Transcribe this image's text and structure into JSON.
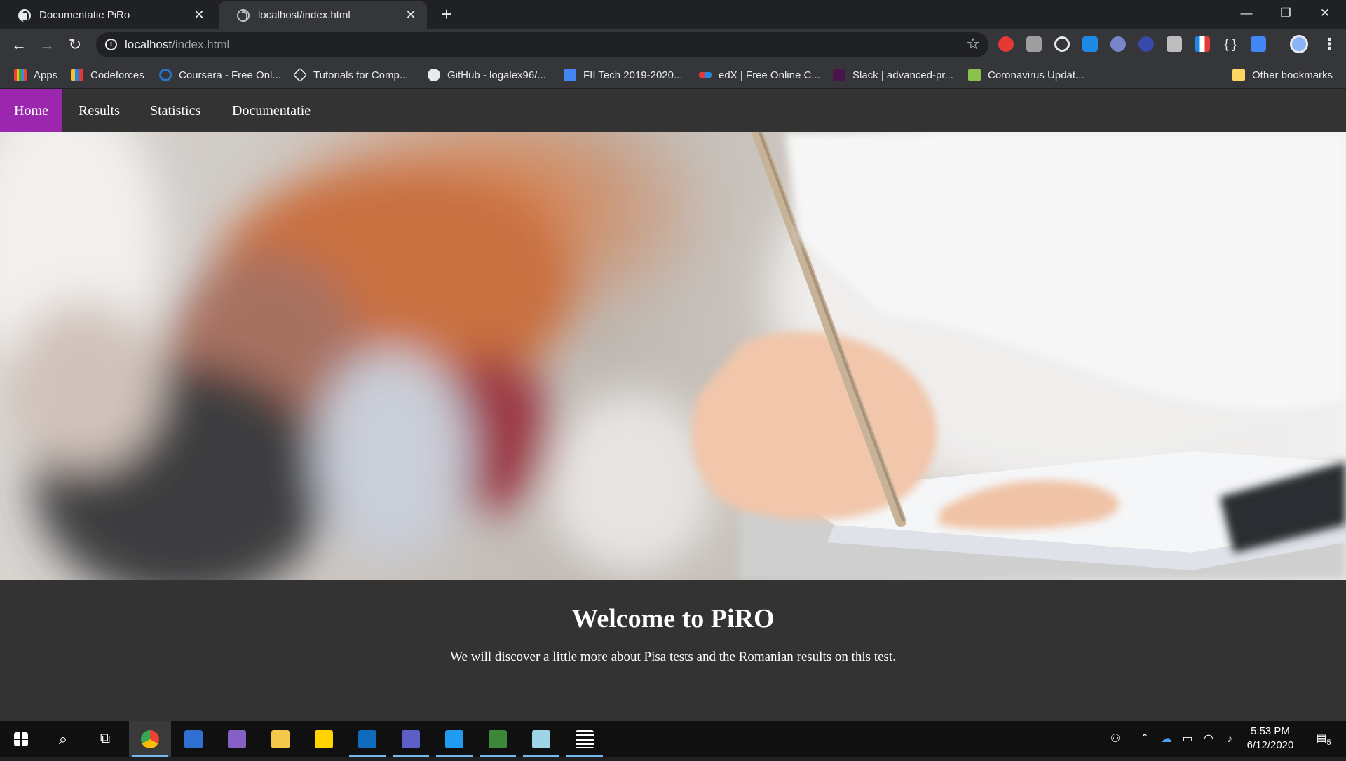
{
  "browser": {
    "tabs": [
      {
        "title": "Documentatie PiRo",
        "active": false
      },
      {
        "title": "localhost/index.html",
        "active": true
      }
    ],
    "new_tab": "+",
    "window_controls": {
      "minimize": "—",
      "restore": "❐",
      "close": "✕"
    },
    "address_bar": {
      "host": "localhost",
      "path": "/index.html"
    },
    "bookmarks": [
      {
        "label": "Apps",
        "icon": "apps-grid-icon"
      },
      {
        "label": "Codeforces",
        "icon": "codeforces-icon"
      },
      {
        "label": "Coursera - Free Onl...",
        "icon": "coursera-icon"
      },
      {
        "label": "Tutorials for Comp...",
        "icon": "tutorials-icon"
      },
      {
        "label": "GitHub - logalex96/...",
        "icon": "github-icon"
      },
      {
        "label": "FII Tech 2019-2020...",
        "icon": "docs-icon"
      },
      {
        "label": "edX | Free Online C...",
        "icon": "edx-icon"
      },
      {
        "label": "Slack | advanced-pr...",
        "icon": "slack-icon"
      },
      {
        "label": "Coronavirus Updat...",
        "icon": "worldometer-icon"
      }
    ],
    "other_bookmarks": "Other bookmarks"
  },
  "site": {
    "nav": [
      "Home",
      "Results",
      "Statistics",
      "Documentatie"
    ],
    "active_nav": "Home",
    "accent_color": "#9b27af",
    "heading": "Welcome to PiRO",
    "intro": "We will discover a little more about Pisa tests and the Romanian results on this test."
  },
  "taskbar": {
    "time": "5:53 PM",
    "date": "6/12/2020",
    "notifications": "5"
  }
}
